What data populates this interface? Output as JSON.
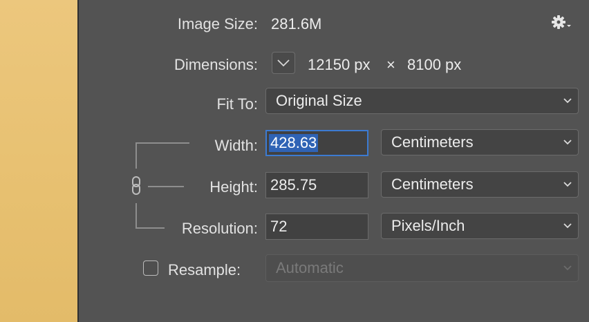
{
  "image_size": {
    "label": "Image Size:",
    "value": "281.6M"
  },
  "dimensions": {
    "label": "Dimensions:",
    "width": "12150 px",
    "separator": "×",
    "height": "8100 px"
  },
  "fit_to": {
    "label": "Fit To:",
    "value": "Original Size"
  },
  "width": {
    "label": "Width:",
    "value": "428.63",
    "unit": "Centimeters"
  },
  "height": {
    "label": "Height:",
    "value": "285.75",
    "unit": "Centimeters"
  },
  "resolution": {
    "label": "Resolution:",
    "value": "72",
    "unit": "Pixels/Inch"
  },
  "resample": {
    "label": "Resample:",
    "value": "Automatic",
    "checked": false
  },
  "icons": {
    "settings": "gear-icon",
    "dimensions_toggle": "chevron-down-icon",
    "constrain": "link-icon"
  },
  "colors": {
    "panel": "#535353",
    "focus": "#3c7bd2",
    "selection": "#2f63b5",
    "preview": "#e7c070"
  }
}
